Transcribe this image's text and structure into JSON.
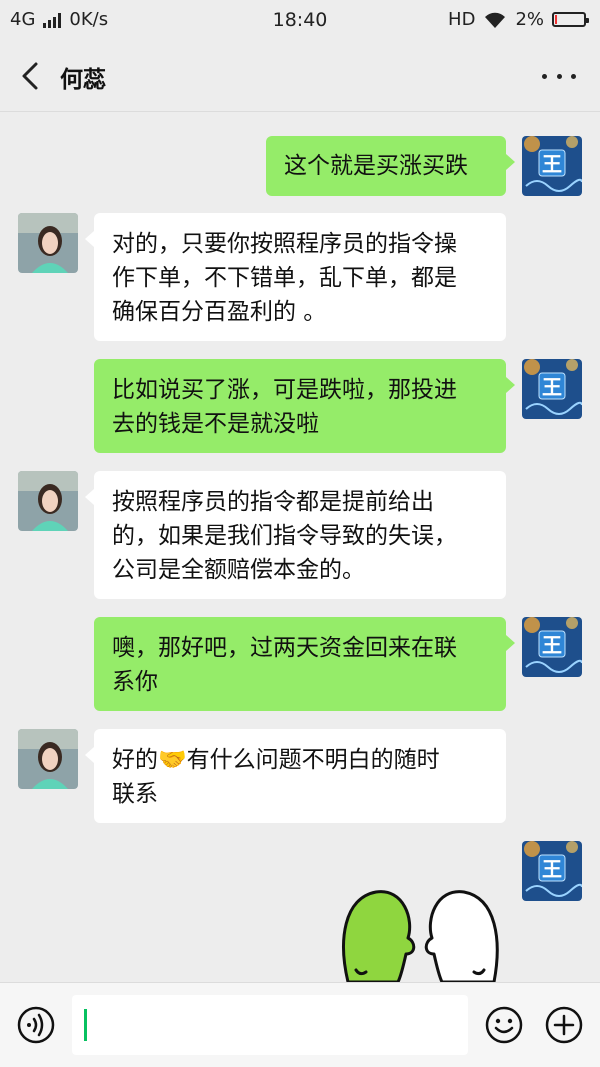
{
  "status_bar": {
    "network": "4G",
    "speed": "0K/s",
    "time": "18:40",
    "hd": "HD",
    "battery": "2%",
    "battery_color": "#e33333"
  },
  "header": {
    "title": "何蕊",
    "back_icon": "chevron-left-icon",
    "more_icon": "more-dots-icon"
  },
  "messages": [
    {
      "side": "out",
      "text": "这个就是买涨买跌"
    },
    {
      "side": "in",
      "text": "对的，只要你按照程序员的指令操\n作下单，不下错单，乱下单，都是\n确保百分百盈利的 。"
    },
    {
      "side": "out",
      "text": "比如说买了涨，可是跌啦，那投进\n去的钱是不是就没啦"
    },
    {
      "side": "in",
      "text": "按照程序员的指令都是提前给出\n的，如果是我们指令导致的失误，\n公司是全额赔偿本金的。"
    },
    {
      "side": "out",
      "text": "噢，那好吧，过两天资金回来在联\n系你"
    },
    {
      "side": "in",
      "text": "好的🤝有什么问题不明白的随时\n联系"
    },
    {
      "side": "out",
      "sticker": "two-beans-sticker"
    }
  ],
  "avatar_self": {
    "letter": "王"
  },
  "colors": {
    "background": "#ededed",
    "bubble_out": "#95ec69",
    "bubble_in": "#ffffff",
    "accent": "#07c160"
  },
  "input_bar": {
    "value": "",
    "voice_icon": "voice-icon",
    "emoji_icon": "emoji-icon",
    "plus_icon": "plus-icon"
  }
}
